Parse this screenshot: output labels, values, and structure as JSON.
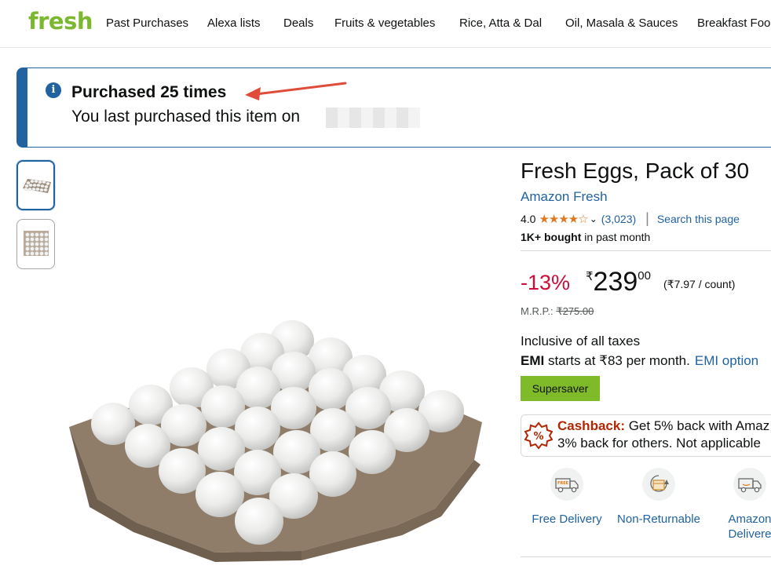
{
  "nav": {
    "brand": "fresh",
    "items": [
      "Past Purchases",
      "Alexa lists",
      "Deals",
      "Fruits & vegetables",
      "Rice, Atta & Dal",
      "Oil, Masala & Sauces",
      "Breakfast Foo"
    ]
  },
  "banner": {
    "heading": "Purchased 25 times",
    "sub": "You last purchased this item on"
  },
  "product": {
    "title": "Fresh Eggs, Pack of 30",
    "brand": "Amazon Fresh",
    "rating": "4.0",
    "rating_value": 4.0,
    "rating_count": "(3,023)",
    "search_page": "Search this page",
    "bought_bold": "1K+ bought",
    "bought_rest": " in past month",
    "discount": "-13%",
    "currency": "₹",
    "price_whole": "239",
    "price_fraction": "00",
    "per_count": "(₹7.97 / count)",
    "mrp_label": "M.R.P.:",
    "mrp": "₹275.00",
    "taxes": "Inclusive of all taxes",
    "emi_bold": "EMI",
    "emi_rest": " starts at ₹83 per month.",
    "emi_link": "EMI option",
    "badge": "Supersaver",
    "cashback_label": "Cashback:",
    "cashback_line1": " Get 5% back with Amaz",
    "cashback_line2": "3% back for others. Not applicable",
    "features": [
      {
        "icon": "free-delivery-truck-icon",
        "label1": "Free Delivery",
        "label2": ""
      },
      {
        "icon": "non-returnable-box-icon",
        "label1": "Non-Returnable",
        "label2": ""
      },
      {
        "icon": "amazon-delivered-truck-icon",
        "label1": "Amazon",
        "label2": "Delivere"
      }
    ]
  },
  "colors": {
    "brand_green": "#7cb82f",
    "link_blue": "#2162a1",
    "discount_red": "#cc0c39",
    "star_orange": "#de7921",
    "badge_green": "#7fba28"
  }
}
